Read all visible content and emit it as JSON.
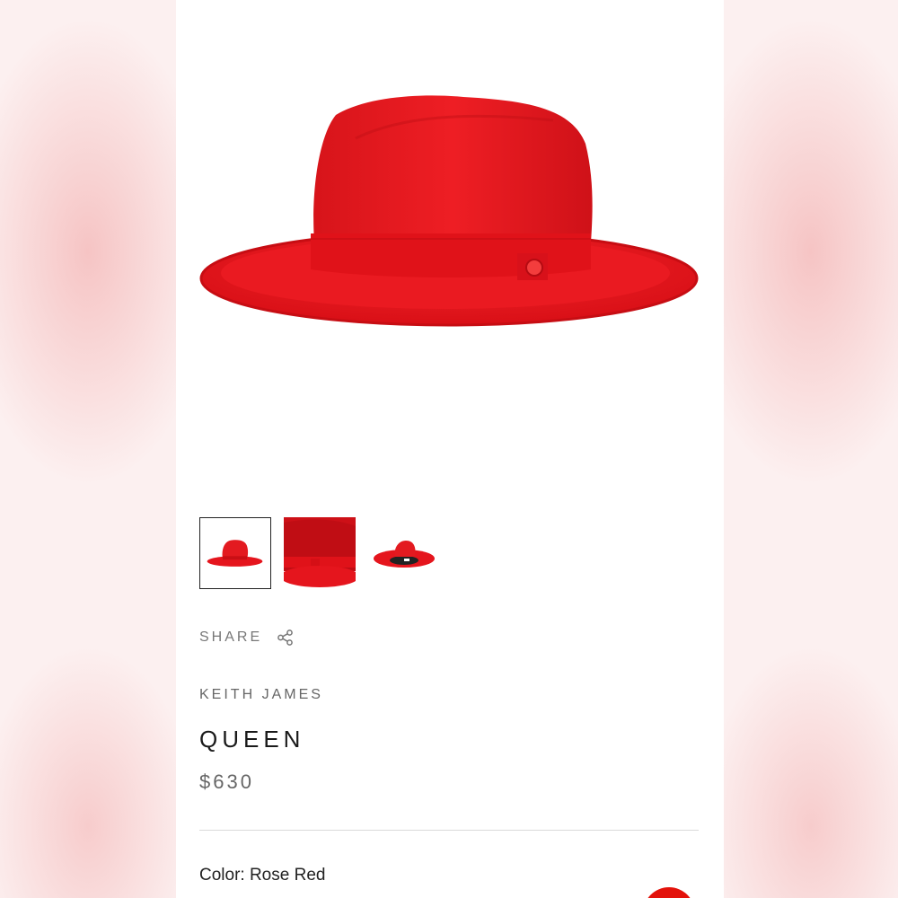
{
  "gallery": {
    "thumbnails": [
      {
        "name": "front view",
        "active": true
      },
      {
        "name": "detail view",
        "active": false
      },
      {
        "name": "underside view",
        "active": false
      }
    ]
  },
  "share": {
    "label": "SHARE",
    "icon": "share-icon"
  },
  "product": {
    "brand": "KEITH JAMES",
    "title": "QUEEN",
    "price": "$630",
    "color_line": "Color: Rose Red"
  },
  "colors": {
    "hat_red": "#e5151d",
    "accent_red": "#e3120b",
    "text_dark": "#1a1a1a",
    "text_muted": "#666666"
  }
}
